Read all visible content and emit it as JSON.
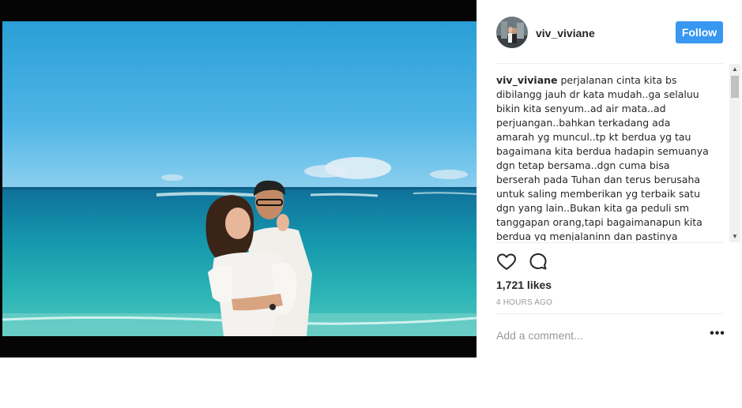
{
  "header": {
    "username": "viv_viviane",
    "follow_label": "Follow"
  },
  "caption": {
    "username": "viv_viviane",
    "text": "perjalanan cinta kita bs dibilangg jauh dr kata mudah..ga selaluu bikin kita senyum..ad air mata..ad perjuangan..bahkan terkadang ada amarah yg muncul..tp kt berdua yg tau bagaimana kita berdua hadapin semuanya dgn tetap bersama..dgn cuma bisa berserah pada Tuhan dan terus berusaha untuk saling memberikan yg terbaik satu dgn yang lain..Bukan kita ga peduli sm tanggapan orang,tapi bagaimanapun kita berdua yg menjalaninn dan pastinya hanya kita"
  },
  "stats": {
    "likes": "1,721 likes",
    "timestamp": "4 HOURS AGO"
  },
  "comment": {
    "placeholder": "Add a comment..."
  },
  "icons": {
    "like": "heart-icon",
    "comment": "comment-bubble-icon",
    "options": "more-options-icon",
    "scroll_up": "scroll-up-arrow-icon",
    "scroll_down": "scroll-down-arrow-icon"
  },
  "colors": {
    "follow_button": "#3897f0",
    "text": "#262626",
    "muted": "#999999",
    "backdrop": "#050505"
  }
}
